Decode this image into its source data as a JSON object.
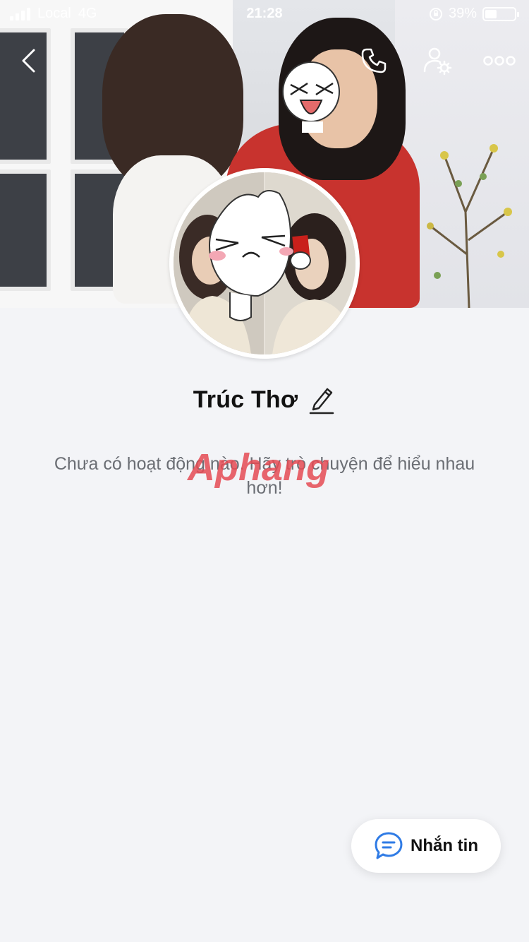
{
  "status_bar": {
    "carrier": "Local",
    "network": "4G",
    "time": "21:28",
    "battery_percent_label": "39%",
    "battery_level": 0.39
  },
  "profile": {
    "name": "Trúc Thơ",
    "empty_activity_message": "Chưa có hoạt động nào. Hãy trò chuyện để hiểu nhau hơn!"
  },
  "actions": {
    "message_label": "Nhắn tin"
  },
  "watermark": {
    "text": "Aphang"
  },
  "colors": {
    "accent": "#2f7be5",
    "background": "#f3f4f7",
    "text_secondary": "#6b6e74"
  },
  "icons": {
    "back": "chevron-left-icon",
    "call": "phone-icon",
    "profile_settings": "user-gear-icon",
    "more": "more-dots-icon",
    "edit": "pencil-icon",
    "message": "chat-bubble-icon"
  }
}
